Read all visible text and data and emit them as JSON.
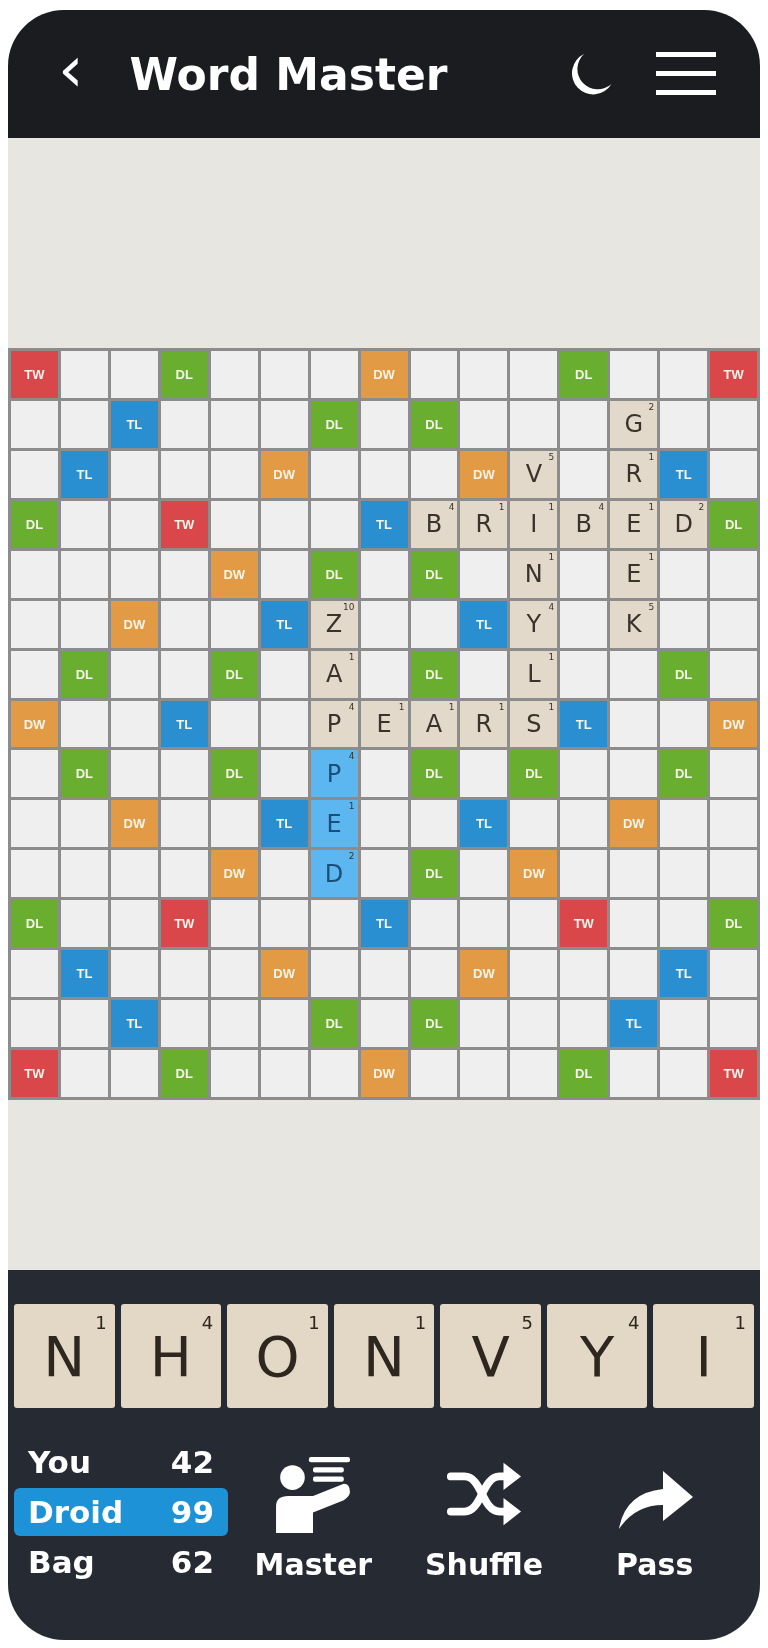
{
  "header": {
    "back": "‹",
    "title": "Word Master"
  },
  "board": {
    "rows": [
      [
        {
          "kind": "tw",
          "label": "TW"
        },
        {
          "kind": "blank"
        },
        {
          "kind": "blank"
        },
        {
          "kind": "dl",
          "label": "DL"
        },
        {
          "kind": "blank"
        },
        {
          "kind": "blank"
        },
        {
          "kind": "blank"
        },
        {
          "kind": "dw",
          "label": "DW"
        },
        {
          "kind": "blank"
        },
        {
          "kind": "blank"
        },
        {
          "kind": "blank"
        },
        {
          "kind": "dl",
          "label": "DL"
        },
        {
          "kind": "blank"
        },
        {
          "kind": "blank"
        },
        {
          "kind": "tw",
          "label": "TW"
        }
      ],
      [
        {
          "kind": "blank"
        },
        {
          "kind": "blank"
        },
        {
          "kind": "tl",
          "label": "TL"
        },
        {
          "kind": "blank"
        },
        {
          "kind": "blank"
        },
        {
          "kind": "blank"
        },
        {
          "kind": "dl",
          "label": "DL"
        },
        {
          "kind": "blank"
        },
        {
          "kind": "dl",
          "label": "DL"
        },
        {
          "kind": "blank"
        },
        {
          "kind": "blank"
        },
        {
          "kind": "blank"
        },
        {
          "kind": "tile",
          "letter": "G",
          "points": "2",
          "selected": false
        },
        {
          "kind": "blank"
        },
        {
          "kind": "blank"
        }
      ],
      [
        {
          "kind": "blank"
        },
        {
          "kind": "tl",
          "label": "TL"
        },
        {
          "kind": "blank"
        },
        {
          "kind": "blank"
        },
        {
          "kind": "blank"
        },
        {
          "kind": "dw",
          "label": "DW"
        },
        {
          "kind": "blank"
        },
        {
          "kind": "blank"
        },
        {
          "kind": "blank"
        },
        {
          "kind": "dw",
          "label": "DW"
        },
        {
          "kind": "tile",
          "letter": "V",
          "points": "5",
          "selected": false
        },
        {
          "kind": "blank"
        },
        {
          "kind": "tile",
          "letter": "R",
          "points": "1",
          "selected": false
        },
        {
          "kind": "tl",
          "label": "TL"
        },
        {
          "kind": "blank"
        }
      ],
      [
        {
          "kind": "dl",
          "label": "DL"
        },
        {
          "kind": "blank"
        },
        {
          "kind": "blank"
        },
        {
          "kind": "tw",
          "label": "TW"
        },
        {
          "kind": "blank"
        },
        {
          "kind": "blank"
        },
        {
          "kind": "blank"
        },
        {
          "kind": "tl",
          "label": "TL"
        },
        {
          "kind": "tile",
          "letter": "B",
          "points": "4",
          "selected": false
        },
        {
          "kind": "tile",
          "letter": "R",
          "points": "1",
          "selected": false
        },
        {
          "kind": "tile",
          "letter": "I",
          "points": "1",
          "selected": false
        },
        {
          "kind": "tile",
          "letter": "B",
          "points": "4",
          "selected": false
        },
        {
          "kind": "tile",
          "letter": "E",
          "points": "1",
          "selected": false
        },
        {
          "kind": "tile",
          "letter": "D",
          "points": "2",
          "selected": false
        },
        {
          "kind": "dl",
          "label": "DL"
        }
      ],
      [
        {
          "kind": "blank"
        },
        {
          "kind": "blank"
        },
        {
          "kind": "blank"
        },
        {
          "kind": "blank"
        },
        {
          "kind": "dw",
          "label": "DW"
        },
        {
          "kind": "blank"
        },
        {
          "kind": "dl",
          "label": "DL"
        },
        {
          "kind": "blank"
        },
        {
          "kind": "dl",
          "label": "DL"
        },
        {
          "kind": "blank"
        },
        {
          "kind": "tile",
          "letter": "N",
          "points": "1",
          "selected": false
        },
        {
          "kind": "blank"
        },
        {
          "kind": "tile",
          "letter": "E",
          "points": "1",
          "selected": false
        },
        {
          "kind": "blank"
        },
        {
          "kind": "blank"
        }
      ],
      [
        {
          "kind": "blank"
        },
        {
          "kind": "blank"
        },
        {
          "kind": "dw",
          "label": "DW"
        },
        {
          "kind": "blank"
        },
        {
          "kind": "blank"
        },
        {
          "kind": "tl",
          "label": "TL"
        },
        {
          "kind": "tile",
          "letter": "Z",
          "points": "10",
          "selected": false
        },
        {
          "kind": "blank"
        },
        {
          "kind": "blank"
        },
        {
          "kind": "tl",
          "label": "TL"
        },
        {
          "kind": "tile",
          "letter": "Y",
          "points": "4",
          "selected": false
        },
        {
          "kind": "blank"
        },
        {
          "kind": "tile",
          "letter": "K",
          "points": "5",
          "selected": false
        },
        {
          "kind": "blank"
        },
        {
          "kind": "blank"
        }
      ],
      [
        {
          "kind": "blank"
        },
        {
          "kind": "dl",
          "label": "DL"
        },
        {
          "kind": "blank"
        },
        {
          "kind": "blank"
        },
        {
          "kind": "dl",
          "label": "DL"
        },
        {
          "kind": "blank"
        },
        {
          "kind": "tile",
          "letter": "A",
          "points": "1",
          "selected": false
        },
        {
          "kind": "blank"
        },
        {
          "kind": "dl",
          "label": "DL"
        },
        {
          "kind": "blank"
        },
        {
          "kind": "tile",
          "letter": "L",
          "points": "1",
          "selected": false
        },
        {
          "kind": "blank"
        },
        {
          "kind": "blank"
        },
        {
          "kind": "dl",
          "label": "DL"
        },
        {
          "kind": "blank"
        }
      ],
      [
        {
          "kind": "dw",
          "label": "DW"
        },
        {
          "kind": "blank"
        },
        {
          "kind": "blank"
        },
        {
          "kind": "tl",
          "label": "TL"
        },
        {
          "kind": "blank"
        },
        {
          "kind": "blank"
        },
        {
          "kind": "tile",
          "letter": "P",
          "points": "4",
          "selected": false
        },
        {
          "kind": "tile",
          "letter": "E",
          "points": "1",
          "selected": false
        },
        {
          "kind": "tile",
          "letter": "A",
          "points": "1",
          "selected": false
        },
        {
          "kind": "tile",
          "letter": "R",
          "points": "1",
          "selected": false
        },
        {
          "kind": "tile",
          "letter": "S",
          "points": "1",
          "selected": false
        },
        {
          "kind": "tl",
          "label": "TL"
        },
        {
          "kind": "blank"
        },
        {
          "kind": "blank"
        },
        {
          "kind": "dw",
          "label": "DW"
        }
      ],
      [
        {
          "kind": "blank"
        },
        {
          "kind": "dl",
          "label": "DL"
        },
        {
          "kind": "blank"
        },
        {
          "kind": "blank"
        },
        {
          "kind": "dl",
          "label": "DL"
        },
        {
          "kind": "blank"
        },
        {
          "kind": "tile",
          "letter": "P",
          "points": "4",
          "selected": true
        },
        {
          "kind": "blank"
        },
        {
          "kind": "dl",
          "label": "DL"
        },
        {
          "kind": "blank"
        },
        {
          "kind": "dl",
          "label": "DL"
        },
        {
          "kind": "blank"
        },
        {
          "kind": "blank"
        },
        {
          "kind": "dl",
          "label": "DL"
        },
        {
          "kind": "blank"
        }
      ],
      [
        {
          "kind": "blank"
        },
        {
          "kind": "blank"
        },
        {
          "kind": "dw",
          "label": "DW"
        },
        {
          "kind": "blank"
        },
        {
          "kind": "blank"
        },
        {
          "kind": "tl",
          "label": "TL"
        },
        {
          "kind": "tile",
          "letter": "E",
          "points": "1",
          "selected": true
        },
        {
          "kind": "blank"
        },
        {
          "kind": "blank"
        },
        {
          "kind": "tl",
          "label": "TL"
        },
        {
          "kind": "blank"
        },
        {
          "kind": "blank"
        },
        {
          "kind": "dw",
          "label": "DW"
        },
        {
          "kind": "blank"
        },
        {
          "kind": "blank"
        }
      ],
      [
        {
          "kind": "blank"
        },
        {
          "kind": "blank"
        },
        {
          "kind": "blank"
        },
        {
          "kind": "blank"
        },
        {
          "kind": "dw",
          "label": "DW"
        },
        {
          "kind": "blank"
        },
        {
          "kind": "tile",
          "letter": "D",
          "points": "2",
          "selected": true
        },
        {
          "kind": "blank"
        },
        {
          "kind": "dl",
          "label": "DL"
        },
        {
          "kind": "blank"
        },
        {
          "kind": "dw",
          "label": "DW"
        },
        {
          "kind": "blank"
        },
        {
          "kind": "blank"
        },
        {
          "kind": "blank"
        },
        {
          "kind": "blank"
        }
      ],
      [
        {
          "kind": "dl",
          "label": "DL"
        },
        {
          "kind": "blank"
        },
        {
          "kind": "blank"
        },
        {
          "kind": "tw",
          "label": "TW"
        },
        {
          "kind": "blank"
        },
        {
          "kind": "blank"
        },
        {
          "kind": "blank"
        },
        {
          "kind": "tl",
          "label": "TL"
        },
        {
          "kind": "blank"
        },
        {
          "kind": "blank"
        },
        {
          "kind": "blank"
        },
        {
          "kind": "tw",
          "label": "TW"
        },
        {
          "kind": "blank"
        },
        {
          "kind": "blank"
        },
        {
          "kind": "dl",
          "label": "DL"
        }
      ],
      [
        {
          "kind": "blank"
        },
        {
          "kind": "tl",
          "label": "TL"
        },
        {
          "kind": "blank"
        },
        {
          "kind": "blank"
        },
        {
          "kind": "blank"
        },
        {
          "kind": "dw",
          "label": "DW"
        },
        {
          "kind": "blank"
        },
        {
          "kind": "blank"
        },
        {
          "kind": "blank"
        },
        {
          "kind": "dw",
          "label": "DW"
        },
        {
          "kind": "blank"
        },
        {
          "kind": "blank"
        },
        {
          "kind": "blank"
        },
        {
          "kind": "tl",
          "label": "TL"
        },
        {
          "kind": "blank"
        }
      ],
      [
        {
          "kind": "blank"
        },
        {
          "kind": "blank"
        },
        {
          "kind": "tl",
          "label": "TL"
        },
        {
          "kind": "blank"
        },
        {
          "kind": "blank"
        },
        {
          "kind": "blank"
        },
        {
          "kind": "dl",
          "label": "DL"
        },
        {
          "kind": "blank"
        },
        {
          "kind": "dl",
          "label": "DL"
        },
        {
          "kind": "blank"
        },
        {
          "kind": "blank"
        },
        {
          "kind": "blank"
        },
        {
          "kind": "tl",
          "label": "TL"
        },
        {
          "kind": "blank"
        },
        {
          "kind": "blank"
        }
      ],
      [
        {
          "kind": "tw",
          "label": "TW"
        },
        {
          "kind": "blank"
        },
        {
          "kind": "blank"
        },
        {
          "kind": "dl",
          "label": "DL"
        },
        {
          "kind": "blank"
        },
        {
          "kind": "blank"
        },
        {
          "kind": "blank"
        },
        {
          "kind": "dw",
          "label": "DW"
        },
        {
          "kind": "blank"
        },
        {
          "kind": "blank"
        },
        {
          "kind": "blank"
        },
        {
          "kind": "dl",
          "label": "DL"
        },
        {
          "kind": "blank"
        },
        {
          "kind": "blank"
        },
        {
          "kind": "tw",
          "label": "TW"
        }
      ]
    ]
  },
  "rack": [
    {
      "letter": "N",
      "points": "1"
    },
    {
      "letter": "H",
      "points": "4"
    },
    {
      "letter": "O",
      "points": "1"
    },
    {
      "letter": "N",
      "points": "1"
    },
    {
      "letter": "V",
      "points": "5"
    },
    {
      "letter": "Y",
      "points": "4"
    },
    {
      "letter": "I",
      "points": "1"
    }
  ],
  "scores": [
    {
      "label": "You",
      "value": "42",
      "selected": false
    },
    {
      "label": "Droid",
      "value": "99",
      "selected": true
    },
    {
      "label": "Bag",
      "value": "62",
      "selected": false
    }
  ],
  "actions": [
    {
      "kind": "master",
      "label": "Master"
    },
    {
      "kind": "shuffle",
      "label": "Shuffle"
    },
    {
      "kind": "pass",
      "label": "Pass"
    }
  ]
}
